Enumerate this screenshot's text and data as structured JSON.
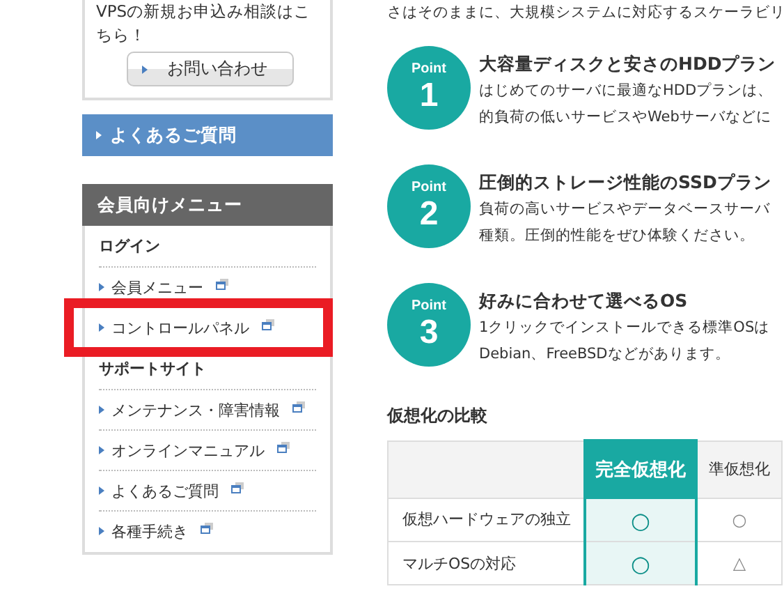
{
  "sidebar": {
    "contact_box": {
      "text": "VPSの新規お申込み相談はこちら！",
      "button": "お問い合わせ"
    },
    "faq_link": "よくあるご質問",
    "member_menu": {
      "title": "会員向けメニュー",
      "sections": [
        {
          "heading": "ログイン",
          "items": [
            {
              "label": "会員メニュー",
              "highlighted": false
            },
            {
              "label": "コントロールパネル",
              "highlighted": true
            }
          ]
        },
        {
          "heading": "サポートサイト",
          "items": [
            {
              "label": "メンテナンス・障害情報",
              "highlighted": false
            },
            {
              "label": "オンラインマニュアル",
              "highlighted": false
            },
            {
              "label": "よくあるご質問",
              "highlighted": false
            },
            {
              "label": "各種手続き",
              "highlighted": false
            }
          ]
        }
      ]
    }
  },
  "main": {
    "intro": "さはそのままに、大規模システムに対応するスケーラビリ",
    "points": [
      {
        "badge": "Point",
        "number": "1",
        "title": "大容量ディスクと安さのHDDプラン",
        "description_lines": [
          "はじめてのサーバに最適なHDDプランは、",
          "的負荷の低いサービスやWebサーバなどに"
        ]
      },
      {
        "badge": "Point",
        "number": "2",
        "title": "圧倒的ストレージ性能のSSDプラン",
        "description_lines": [
          "負荷の高いサービスやデータベースサーバ",
          "種類。圧倒的性能をぜひ体験ください。"
        ]
      },
      {
        "badge": "Point",
        "number": "3",
        "title": "好みに合わせて選べるOS",
        "description_lines": [
          "1クリックでインストールできる標準OSは",
          "Debian、FreeBSDなどがあります。"
        ]
      }
    ],
    "comparison": {
      "title": "仮想化の比較",
      "columns": [
        {
          "label": "完全仮想化",
          "selected": true
        },
        {
          "label": "準仮想化",
          "selected": false
        }
      ],
      "rows": [
        {
          "label": "仮想ハードウェアの独立",
          "values": [
            "○",
            "○"
          ]
        },
        {
          "label": "マルチOSの対応",
          "values": [
            "○",
            "△"
          ]
        }
      ]
    }
  }
}
